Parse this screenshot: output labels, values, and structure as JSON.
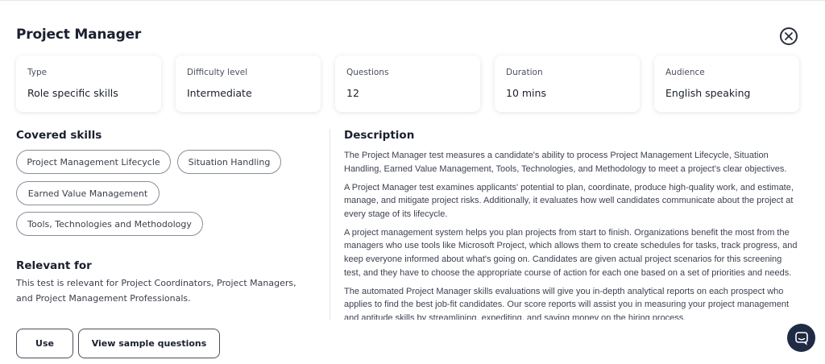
{
  "modal": {
    "title": "Project Manager",
    "close_icon": "close-circle-icon"
  },
  "info_cards": [
    {
      "label": "Type",
      "value": "Role specific skills"
    },
    {
      "label": "Difficulty level",
      "value": "Intermediate"
    },
    {
      "label": "Questions",
      "value": "12"
    },
    {
      "label": "Duration",
      "value": "10 mins"
    },
    {
      "label": "Audience",
      "value": "English speaking"
    }
  ],
  "covered_skills": {
    "heading": "Covered skills",
    "skills": [
      "Project Management Lifecycle",
      "Situation Handling",
      "Earned Value Management",
      "Tools, Technologies and Methodology"
    ]
  },
  "relevant_for": {
    "heading": "Relevant for",
    "text": "This test is relevant for Project Coordinators, Project Managers, and Project Management Professionals."
  },
  "description": {
    "heading": "Description",
    "paragraphs": [
      "The Project Manager test measures a candidate's ability to process Project Management Lifecycle, Situation Handling, Earned Value Management, Tools, Technologies, and Methodology to meet a project's clear objectives.",
      "A Project Manager test examines applicants' potential to plan, coordinate, produce high-quality work, and estimate, manage, and mitigate project risks. Additionally, it evaluates how well candidates communicate about the project at every stage of its lifecycle.",
      "A project management system helps you plan projects from start to finish. Organizations benefit the most from the managers who use tools like Microsoft Project, which allows them to create schedules for tasks, track progress, and keep everyone informed about what's going on. Candidates are given actual project scenarios for this screening test, and they have to choose the appropriate course of action for each one based on a set of priorities and needs.",
      "The automated Project Manager skills evaluations will give you in-depth analytical reports on each prospect who applies to find the best job-fit candidates. Our score reports will assist you in measuring your project management and aptitude skills by streamlining, expediting, and saving money on the hiring process."
    ]
  },
  "actions": {
    "use_label": "Use",
    "sample_label": "View sample questions"
  },
  "chat_widget": {
    "icon": "chat-bubble-icon",
    "color": "#1f2a44"
  }
}
